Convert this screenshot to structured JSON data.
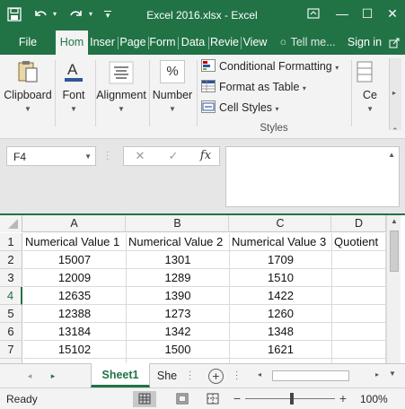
{
  "window": {
    "title": "Excel 2016.xlsx - Excel",
    "qat": {
      "save_icon": "save-icon",
      "undo_icon": "undo-icon",
      "redo_icon": "redo-icon",
      "customize_icon": "qat-customize-icon"
    },
    "controls": {
      "restore_ribbon_icon": "ribbon-display-icon",
      "minimize": "—",
      "maximize": "☐",
      "close": "✕"
    }
  },
  "tabs": [
    {
      "label": "File"
    },
    {
      "label": "Hom",
      "active": true
    },
    {
      "label": "Inser"
    },
    {
      "label": "Page"
    },
    {
      "label": "Form"
    },
    {
      "label": "Data"
    },
    {
      "label": "Revie"
    },
    {
      "label": "View"
    },
    {
      "label": "Tell me..."
    },
    {
      "label": "Sign in"
    }
  ],
  "ribbon": {
    "clipboard": {
      "label": "Clipboard",
      "icon": "clipboard-icon"
    },
    "font": {
      "label": "Font",
      "icon": "font-color-icon"
    },
    "alignment": {
      "label": "Alignment",
      "icon": "align-icon"
    },
    "number": {
      "label": "Number",
      "icon": "percent-icon",
      "symbol": "%"
    },
    "styles": {
      "items": [
        {
          "label": "Conditional Formatting",
          "icon": "conditional-formatting-icon"
        },
        {
          "label": "Format as Table",
          "icon": "format-table-icon"
        },
        {
          "label": "Cell Styles",
          "icon": "cell-styles-icon"
        }
      ],
      "group_label": "Styles"
    },
    "cells": {
      "label": "Ce",
      "icon": "cells-icon"
    }
  },
  "formula_bar": {
    "name_box": "F4",
    "cancel_symbol": "✕",
    "enter_symbol": "✓",
    "fx_symbol": "fx",
    "formula": ""
  },
  "grid": {
    "columns": [
      "A",
      "B",
      "C",
      "D"
    ],
    "rows": [
      "1",
      "2",
      "3",
      "4",
      "5",
      "6",
      "7"
    ],
    "selected_row": "4",
    "cells": [
      [
        "Numerical Value 1",
        "Numerical Value 2",
        "Numerical Value 3",
        "Quotient"
      ],
      [
        "15007",
        "1301",
        "1709",
        ""
      ],
      [
        "12009",
        "1289",
        "1510",
        ""
      ],
      [
        "12635",
        "1390",
        "1422",
        ""
      ],
      [
        "12388",
        "1273",
        "1260",
        ""
      ],
      [
        "13184",
        "1342",
        "1348",
        ""
      ],
      [
        "15102",
        "1500",
        "1621",
        ""
      ]
    ]
  },
  "sheets": {
    "tabs": [
      "Sheet1",
      "She"
    ],
    "active": "Sheet1",
    "add_symbol": "+"
  },
  "status": {
    "ready": "Ready",
    "zoom_minus": "−",
    "zoom_plus": "+",
    "zoom": "100%"
  }
}
